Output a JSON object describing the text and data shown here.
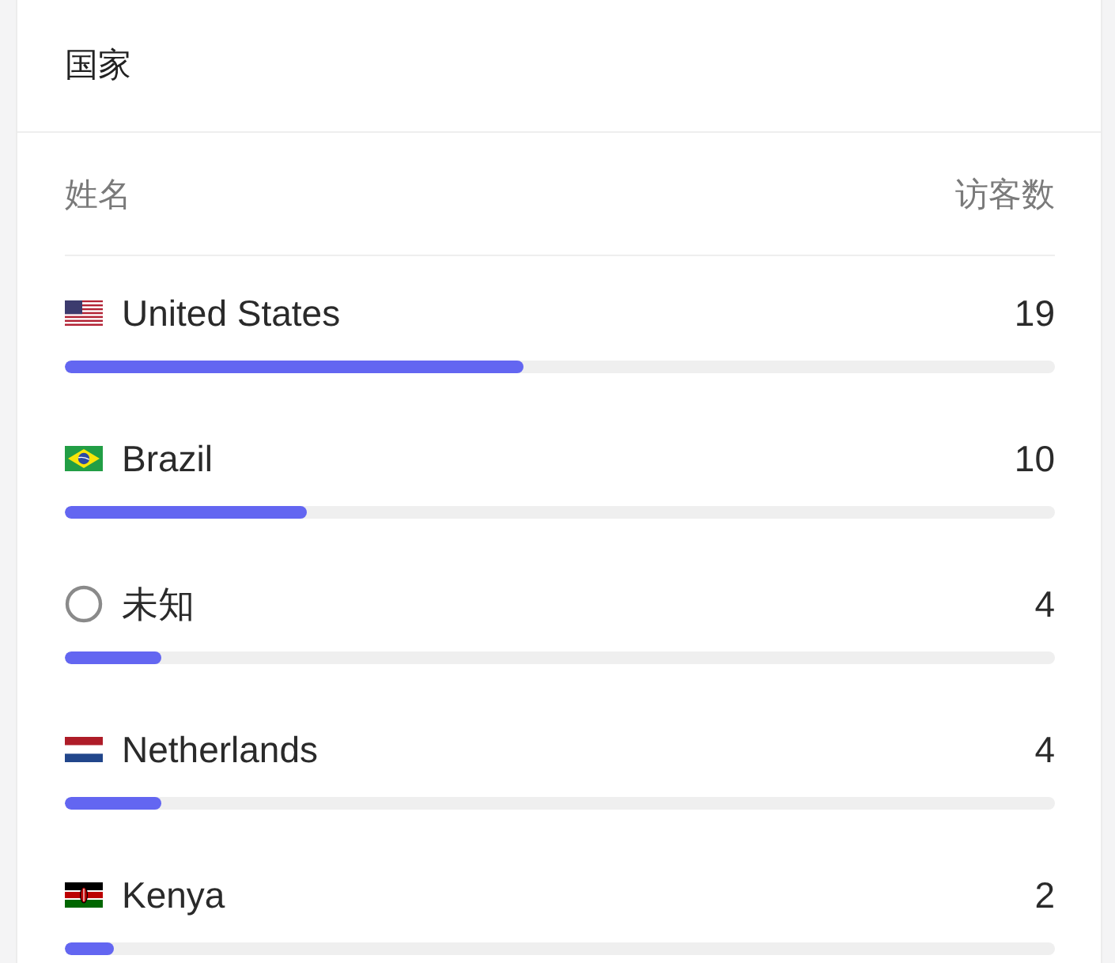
{
  "card": {
    "title": "国家"
  },
  "columns": [
    "姓名",
    "访客数"
  ],
  "rows": [
    {
      "kind": "us",
      "name": "United States",
      "count": "19",
      "level": 0.463
    },
    {
      "kind": "br",
      "name": "Brazil",
      "count": "10",
      "level": 0.244
    },
    {
      "kind": "unknown",
      "name": "未知",
      "count": "4",
      "level": 0.098
    },
    {
      "kind": "nl",
      "name": "Netherlands",
      "count": "4",
      "level": 0.098
    },
    {
      "kind": "ke",
      "name": "Kenya",
      "count": "2",
      "level": 0.049
    }
  ]
}
